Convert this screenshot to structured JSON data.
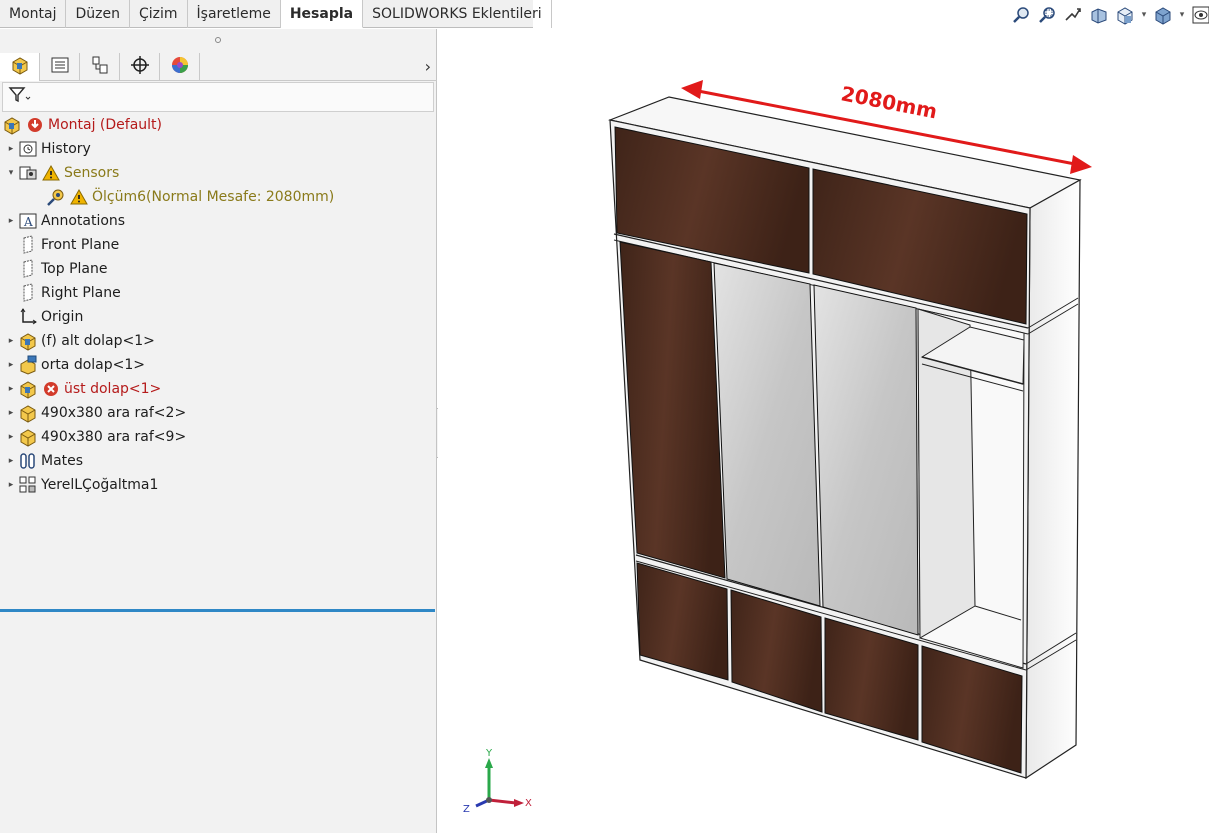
{
  "ribbon": {
    "tabs": [
      "Montaj",
      "Düzen",
      "Çizim",
      "İşaretleme",
      "Hesapla",
      "SOLIDWORKS Eklentileri"
    ],
    "active_index": 4
  },
  "view_toolbar": {
    "icons": [
      "zoom-to-fit-icon",
      "zoom-to-area-icon",
      "previous-view-icon",
      "section-view-icon",
      "view-orientation-icon",
      "display-style-icon",
      "hide-show-icon"
    ]
  },
  "feature_tree": {
    "root": {
      "label": "Montaj  (Default)"
    },
    "items": [
      {
        "label": "History"
      },
      {
        "label": "Sensors"
      },
      {
        "label": "Ölçüm6(Normal Mesafe: 2080mm)"
      },
      {
        "label": "Annotations"
      },
      {
        "label": "Front Plane"
      },
      {
        "label": "Top Plane"
      },
      {
        "label": "Right Plane"
      },
      {
        "label": "Origin"
      },
      {
        "label": "(f) alt dolap<1>"
      },
      {
        "label": "orta dolap<1>"
      },
      {
        "label": "üst dolap<1>"
      },
      {
        "label": "490x380 ara raf<2>"
      },
      {
        "label": "490x380 ara raf<9>"
      },
      {
        "label": "Mates"
      },
      {
        "label": "YerelLÇoğaltma1"
      }
    ]
  },
  "model": {
    "dimension_text": "2080mm",
    "dimension_color": "#e11a1a",
    "wood_color": "#4a2c1f",
    "mirror_color": "#c9c9c9"
  },
  "triad": {
    "x": "X",
    "y": "Y",
    "z": "Z"
  },
  "colors": {
    "accent": "#2f88c6",
    "error": "#d23b2b",
    "warning": "#f0b400"
  }
}
